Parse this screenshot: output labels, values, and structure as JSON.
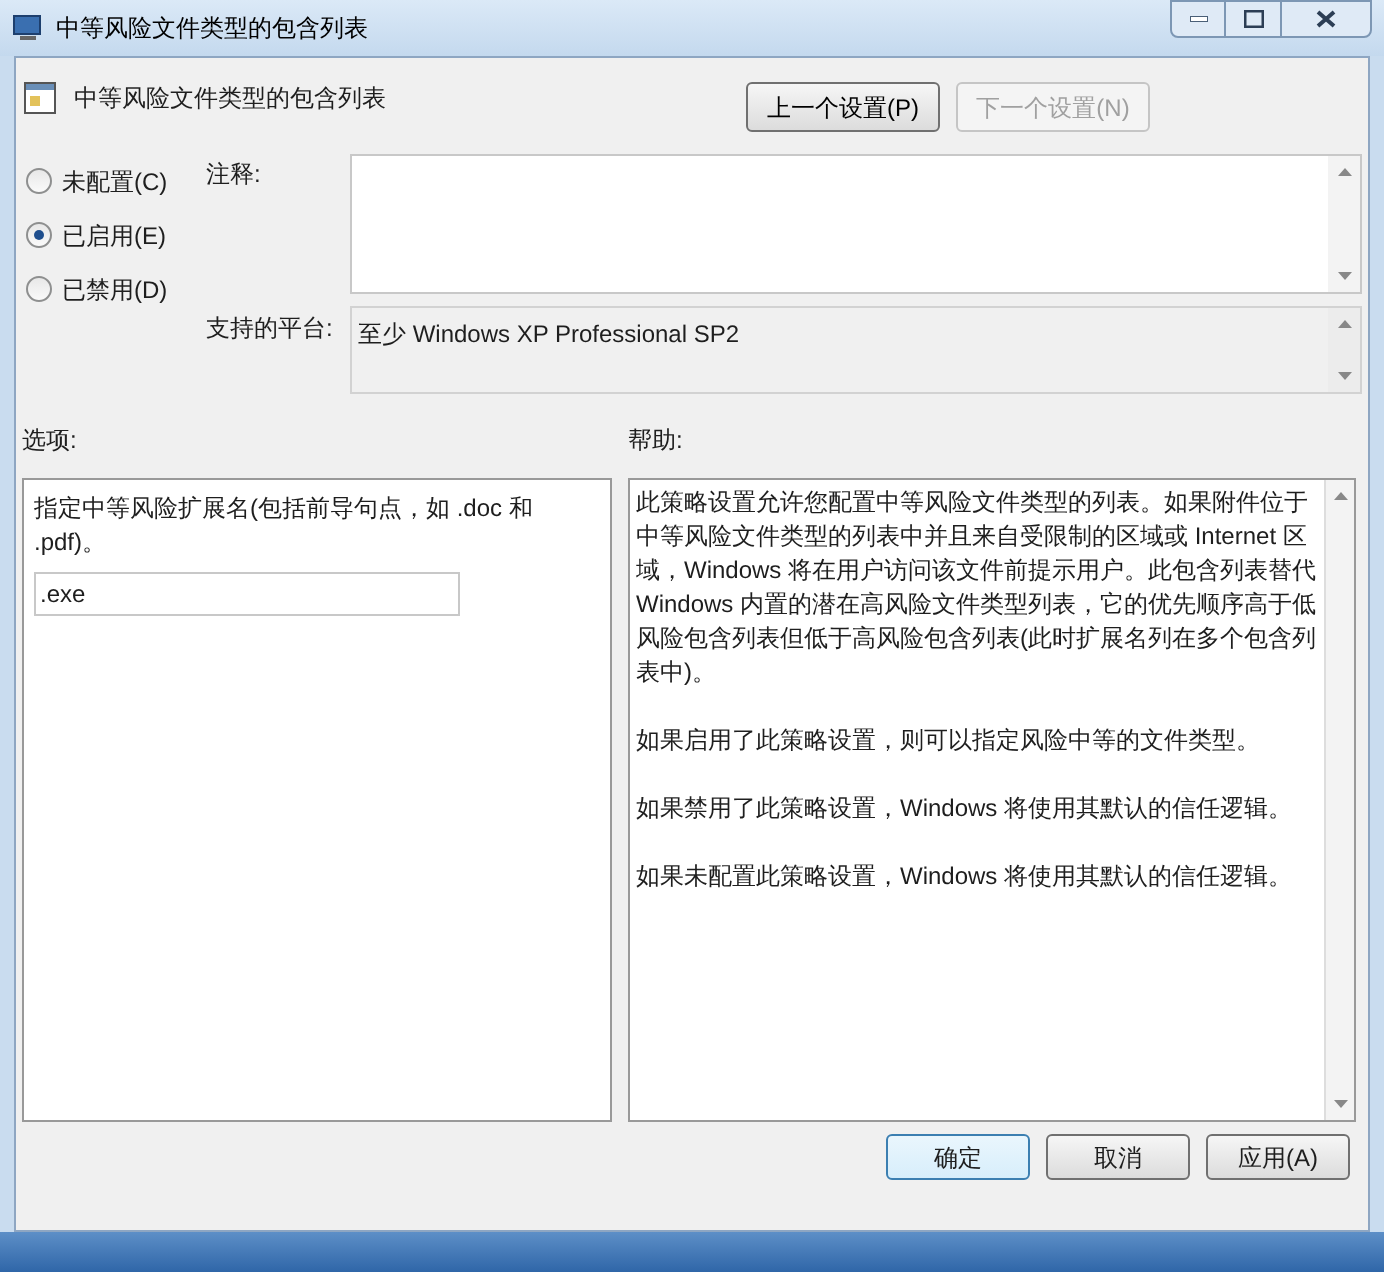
{
  "window": {
    "title": "中等风险文件类型的包含列表"
  },
  "header": {
    "title": "中等风险文件类型的包含列表"
  },
  "nav_buttons": [
    {
      "label": "上一个设置(P)",
      "disabled": false
    },
    {
      "label": "下一个设置(N)",
      "disabled": true
    }
  ],
  "state_options": [
    {
      "label": "未配置(C)",
      "selected": false
    },
    {
      "label": "已启用(E)",
      "selected": true
    },
    {
      "label": "已禁用(D)",
      "selected": false
    }
  ],
  "comment": {
    "label": "注释:"
  },
  "platform": {
    "label": "支持的平台:",
    "value": "至少 Windows XP Professional SP2"
  },
  "options": {
    "label": "选项:",
    "description": "指定中等风险扩展名(包括前导句点，如 .doc 和 .pdf)。",
    "value": ".exe"
  },
  "help": {
    "label": "帮助:",
    "paragraphs": [
      "此策略设置允许您配置中等风险文件类型的列表。如果附件位于中等风险文件类型的列表中并且来自受限制的区域或 Internet 区域，Windows 将在用户访问该文件前提示用户。此包含列表替代 Windows 内置的潜在高风险文件类型列表，它的优先顺序高于低风险包含列表但低于高风险包含列表(此时扩展名列在多个包含列表中)。",
      "如果启用了此策略设置，则可以指定风险中等的文件类型。",
      "如果禁用了此策略设置，Windows 将使用其默认的信任逻辑。",
      "如果未配置此策略设置，Windows 将使用其默认的信任逻辑。"
    ]
  },
  "buttons": [
    "确定",
    "取消",
    "应用(A)"
  ]
}
